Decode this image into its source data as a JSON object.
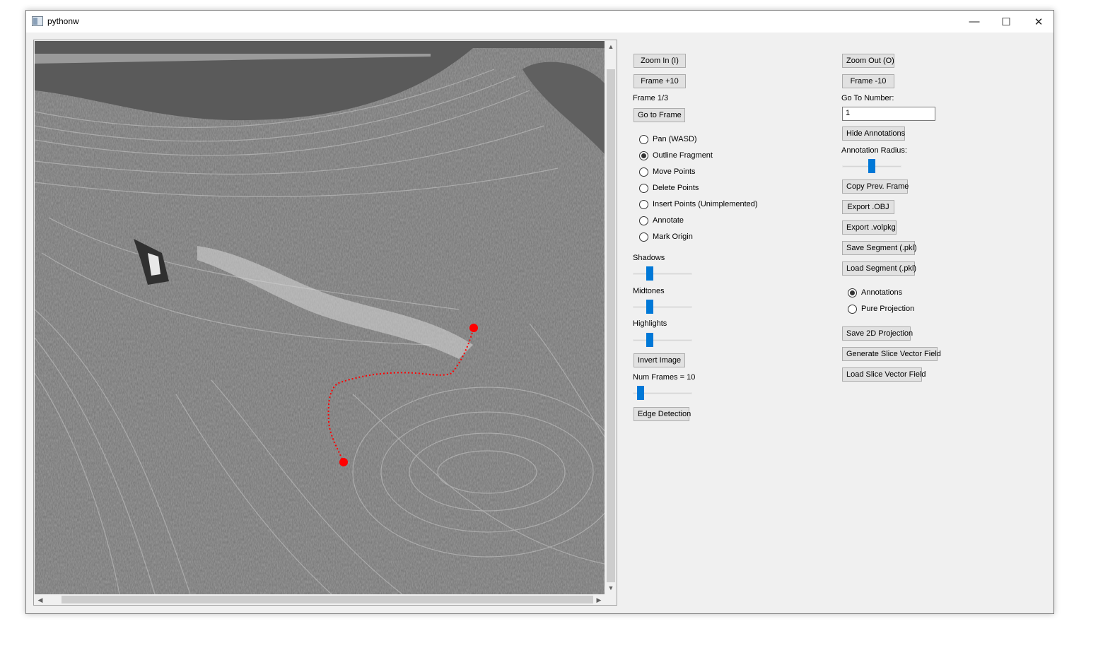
{
  "window": {
    "title": "pythonw",
    "controls": {
      "minimize": "—",
      "maximize": "☐",
      "close": "✕"
    }
  },
  "viewer": {
    "scroll_up": "▲",
    "scroll_down": "▼",
    "scroll_left": "◀",
    "scroll_right": "▶"
  },
  "left_panel": {
    "zoom_in": "Zoom In (I)",
    "frame_plus": "Frame +10",
    "frame_label": "Frame 1/3",
    "go_to_frame": "Go to Frame",
    "modes": [
      {
        "label": "Pan (WASD)",
        "selected": false
      },
      {
        "label": "Outline Fragment",
        "selected": true
      },
      {
        "label": "Move Points",
        "selected": false
      },
      {
        "label": "Delete Points",
        "selected": false
      },
      {
        "label": "Insert Points (Unimplemented)",
        "selected": false
      },
      {
        "label": "Annotate",
        "selected": false
      },
      {
        "label": "Mark Origin",
        "selected": false
      }
    ],
    "shadows_label": "Shadows",
    "shadows_level": 0.25,
    "midtones_label": "Midtones",
    "midtones_level": 0.25,
    "highlights_label": "Highlights",
    "highlights_level": 0.25,
    "invert_image": "Invert Image",
    "num_frames_label": "Num Frames = 10",
    "num_frames_level": 0.08,
    "edge_detection": "Edge Detection"
  },
  "right_panel": {
    "zoom_out": "Zoom Out (O)",
    "frame_minus": "Frame -10",
    "go_to_number_label": "Go To Number:",
    "go_to_number_value": "1",
    "hide_annotations": "Hide Annotations",
    "annotation_radius_label": "Annotation Radius:",
    "annotation_radius_level": 0.5,
    "copy_prev_frame": "Copy Prev. Frame",
    "export_obj": "Export .OBJ",
    "export_volpkg": "Export .volpkg",
    "save_segment": "Save Segment (.pkl)",
    "load_segment": "Load Segment (.pkl)",
    "view_modes": [
      {
        "label": "Annotations",
        "selected": true
      },
      {
        "label": "Pure Projection",
        "selected": false
      }
    ],
    "save_2d_projection": "Save 2D Projection",
    "generate_slice_vector_field": "Generate Slice Vector Field",
    "load_slice_vector_field": "Load Slice Vector Field"
  },
  "colors": {
    "accent": "#0078d7",
    "annotation": "#ff0000",
    "button_bg": "#e1e1e1"
  }
}
